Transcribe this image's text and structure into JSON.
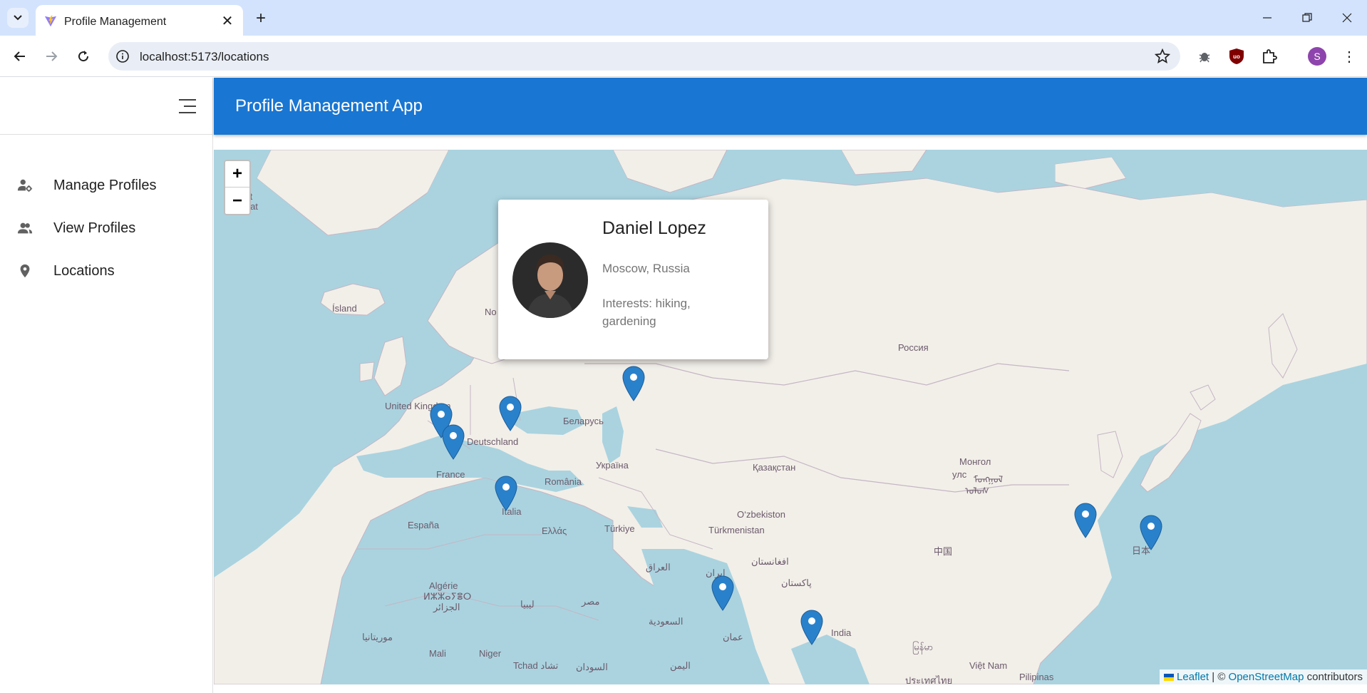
{
  "browser": {
    "tab_title": "Profile Management",
    "url": "localhost:5173/locations",
    "profile_initial": "S"
  },
  "app": {
    "title": "Profile Management App"
  },
  "sidebar": {
    "items": [
      {
        "label": "Manage Profiles",
        "icon": "manage-profiles-icon"
      },
      {
        "label": "View Profiles",
        "icon": "people-icon"
      },
      {
        "label": "Locations",
        "icon": "location-pin-icon"
      }
    ]
  },
  "map": {
    "zoom_in": "+",
    "zoom_out": "−",
    "labels": {
      "nunaat": "Nunaat",
      "ilit": "llit",
      "island": "Ísland",
      "no": "No",
      "russia": "Россия",
      "uk": "United Kingdom",
      "deutschland": "Deutschland",
      "belarus": "Беларусь",
      "ukraine": "Україна",
      "france": "France",
      "romania": "România",
      "kazakhstan": "Қазақстан",
      "mongolia": "Монгол",
      "mongolia_script": "ᠮᠣᠩᠭᠣᠯ",
      "mongolia_script2": "ᠤᠯᠤᠰ",
      "mongolia_uls": "улс",
      "espana": "España",
      "italia": "Italia",
      "ellas": "Ελλάς",
      "turkiye": "Türkiye",
      "uzbekistan": "O‘zbekiston",
      "turkmenistan": "Türkmenistan",
      "china": "中国",
      "iraq": "العراق",
      "afghanistan": "افغانستان",
      "iran": "ایران",
      "pakistan": "پاکستان",
      "algerie": "Algérie",
      "algerie_tifinagh": "ⵍⵣⵣⴰⵢⴻⵔ",
      "algerie_ar": "الجزائر",
      "libya": "ليبيا",
      "egypt": "مصر",
      "saudi": "السعودية",
      "india": "India",
      "japan": "日本",
      "mauritania": "موريتانيا",
      "mali": "Mali",
      "niger": "Niger",
      "tchad": "Tchad تشاد",
      "sudan": "السودان",
      "yemen": "اليمن",
      "oman": "عمان",
      "myanmar": "မြန်မာ",
      "vietnam": "Việt Nam",
      "thailand": "ประเทศไทย",
      "pilipinas": "Pilipinas"
    },
    "popup": {
      "name": "Daniel Lopez",
      "location": "Moscow, Russia",
      "interests": "Interests: hiking, gardening"
    },
    "attribution": {
      "leaflet": "Leaflet",
      "separator": " | © ",
      "osm": "OpenStreetMap",
      "contributors": " contributors"
    }
  }
}
